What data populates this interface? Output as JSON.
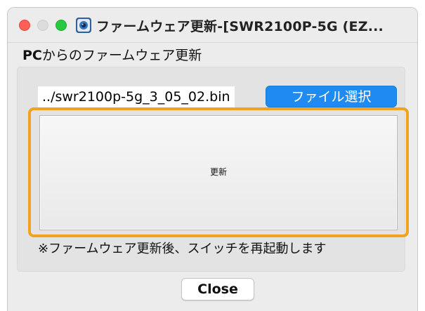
{
  "window": {
    "title": "ファームウェア更新-[SWR2100P-5G (EZ...",
    "traffic_lights": {
      "close_color": "#ff5f57",
      "minimize_color": "#dcdcdc",
      "zoom_color": "#28c840"
    },
    "app_icon": "yamaha-network-icon"
  },
  "section": {
    "label_bold": "PC",
    "label_rest": "からのファームウェア更新"
  },
  "file": {
    "path": "../swr2100p-5g_3_05_02.bin",
    "select_label": "ファイル選択"
  },
  "update": {
    "label": "更新",
    "highlight_color": "#f0a31f"
  },
  "notice": "※ファームウェア更新後、スイッチを再起動します",
  "footer": {
    "close_label": "Close"
  },
  "colors": {
    "accent": "#1f8bf2",
    "window_bg": "#ececec"
  }
}
